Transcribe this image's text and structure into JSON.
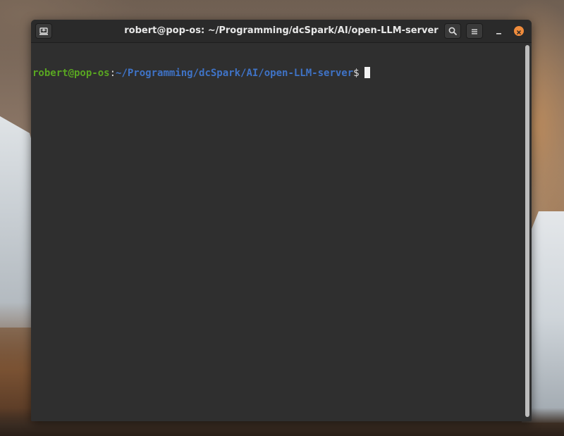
{
  "window": {
    "title": "robert@pop-os: ~/Programming/dcSpark/AI/open-LLM-server"
  },
  "toolbar": {
    "new_tab_icon": "new-tab-icon",
    "search_icon": "search-icon",
    "menu_icon": "hamburger-menu-icon",
    "minimize_icon": "minimize-icon",
    "close_icon": "close-icon",
    "close_color": "#f08c3c"
  },
  "terminal": {
    "prompt": {
      "user_host": "robert@pop-os",
      "separator": ":",
      "path": "~/Programming/dcSpark/AI/open-LLM-server",
      "symbol": "$"
    },
    "colors": {
      "background": "#2f2f2f",
      "user_host": "#59a621",
      "path": "#3f73c6"
    }
  }
}
